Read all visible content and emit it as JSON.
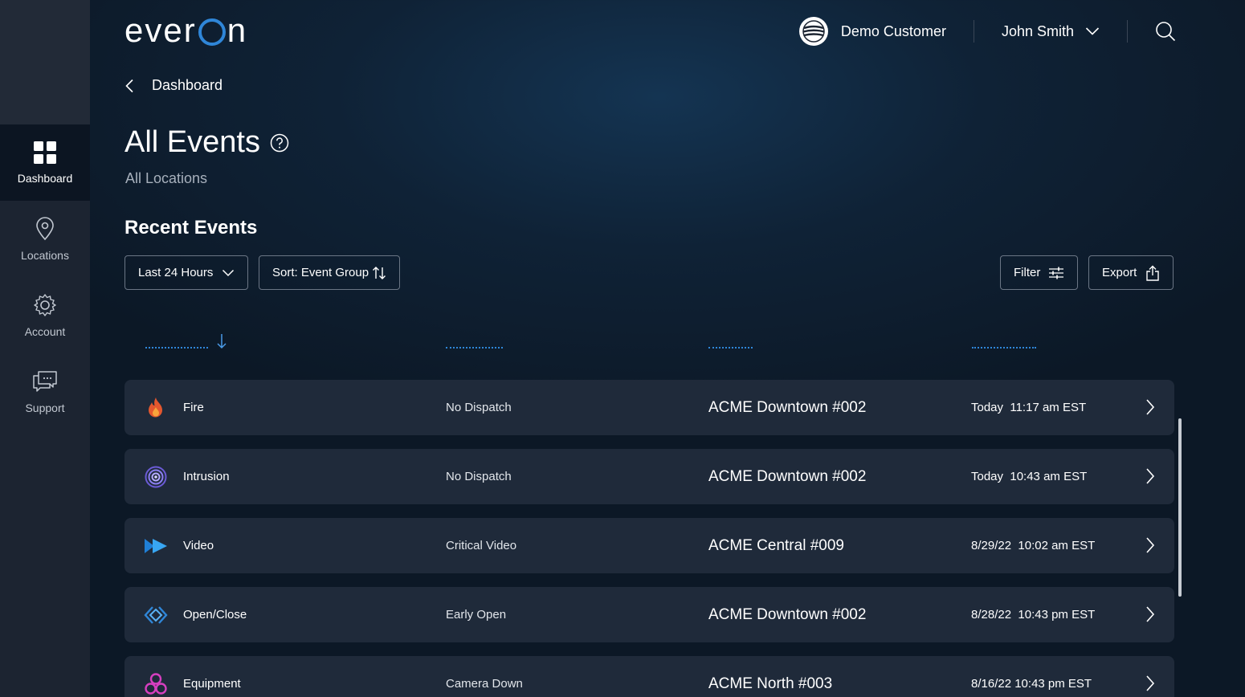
{
  "app": {
    "logo_prefix": "ever",
    "logo_suffix": "n"
  },
  "sidebar": {
    "items": [
      {
        "label": "Dashboard",
        "icon": "grid-icon",
        "active": true
      },
      {
        "label": "Locations",
        "icon": "location-pin-icon",
        "active": false
      },
      {
        "label": "Account",
        "icon": "gear-icon",
        "active": false
      },
      {
        "label": "Support",
        "icon": "chat-icon",
        "active": false
      }
    ]
  },
  "header": {
    "customer": "Demo Customer",
    "user": "John Smith"
  },
  "breadcrumb": {
    "label": "Dashboard"
  },
  "page": {
    "title": "All Events",
    "subtitle": "All Locations",
    "section_title": "Recent Events"
  },
  "controls": {
    "range_label": "Last 24 Hours",
    "sort_label": "Sort: Event Group",
    "filter_label": "Filter",
    "export_label": "Export"
  },
  "events": [
    {
      "type": "Fire",
      "icon": "fire-icon",
      "dispatch": "No Dispatch",
      "location": "ACME Downtown #002",
      "time": "Today  11:17 am EST"
    },
    {
      "type": "Intrusion",
      "icon": "intrusion-icon",
      "dispatch": "No Dispatch",
      "location": "ACME Downtown #002",
      "time": "Today  10:43 am EST"
    },
    {
      "type": "Video",
      "icon": "video-icon",
      "dispatch": "Critical Video",
      "location": "ACME Central #009",
      "time": "8/29/22  10:02 am EST"
    },
    {
      "type": "Open/Close",
      "icon": "open-close-icon",
      "dispatch": "Early Open",
      "location": "ACME Downtown #002",
      "time": "8/28/22  10:43 pm EST"
    },
    {
      "type": "Equipment",
      "icon": "equipment-icon",
      "dispatch": "Camera Down",
      "location": "ACME North #003",
      "time": "8/16/22 10:43 pm EST"
    }
  ],
  "colors": {
    "accent": "#2f86d8",
    "row_bg": "#1f2a3a",
    "sidebar_bg": "#1c2431"
  }
}
